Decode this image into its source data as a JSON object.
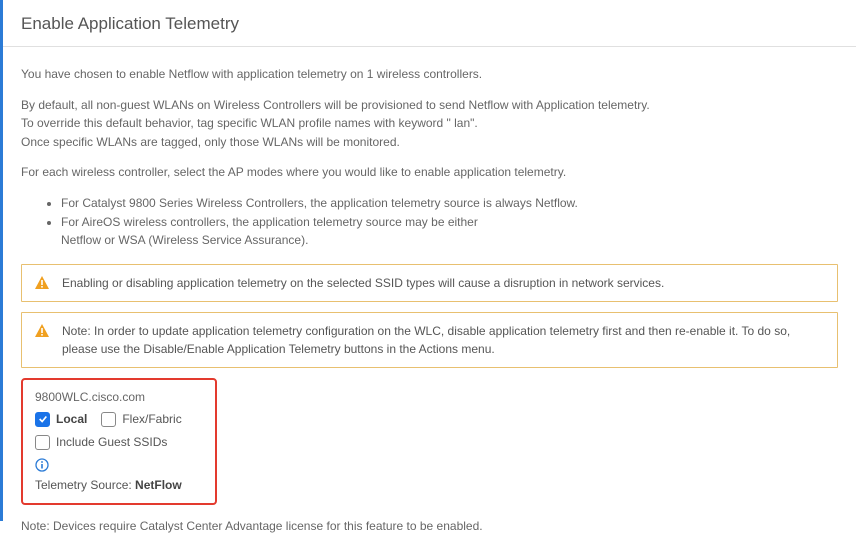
{
  "header": {
    "title": "Enable Application Telemetry"
  },
  "intro": {
    "summary": "You have chosen to enable Netflow with application telemetry on 1 wireless controllers.",
    "default1": "By default, all non-guest WLANs on Wireless Controllers will be provisioned to send Netflow with Application telemetry.",
    "default2": "To override this default behavior, tag specific WLAN profile names with keyword \" lan\".",
    "default3": "Once specific WLANs are tagged, only those WLANs will be monitored.",
    "foreach": "For each wireless controller, select the AP modes where you would like to enable application telemetry.",
    "bullet1": "For Catalyst 9800 Series Wireless Controllers, the application telemetry source is always Netflow.",
    "bullet2a": "For AireOS wireless controllers, the application telemetry source may be either",
    "bullet2b": "Netflow or WSA (Wireless Service Assurance)."
  },
  "alerts": {
    "alert1": "Enabling or disabling application telemetry on the selected SSID types will cause a disruption in network services.",
    "alert2": "Note: In order to update application telemetry configuration on the WLC, disable application telemetry first and then re-enable it. To do so, please use the Disable/Enable Application Telemetry buttons in the Actions menu."
  },
  "controller": {
    "name": "9800WLC.cisco.com",
    "localLabel": "Local",
    "flexLabel": "Flex/Fabric",
    "guestLabel": "Include Guest SSIDs",
    "sourceLabel": "Telemetry Source: ",
    "sourceValue": "NetFlow"
  },
  "footer": {
    "note": "Note: Devices require Catalyst Center Advantage license for this feature to be enabled."
  }
}
